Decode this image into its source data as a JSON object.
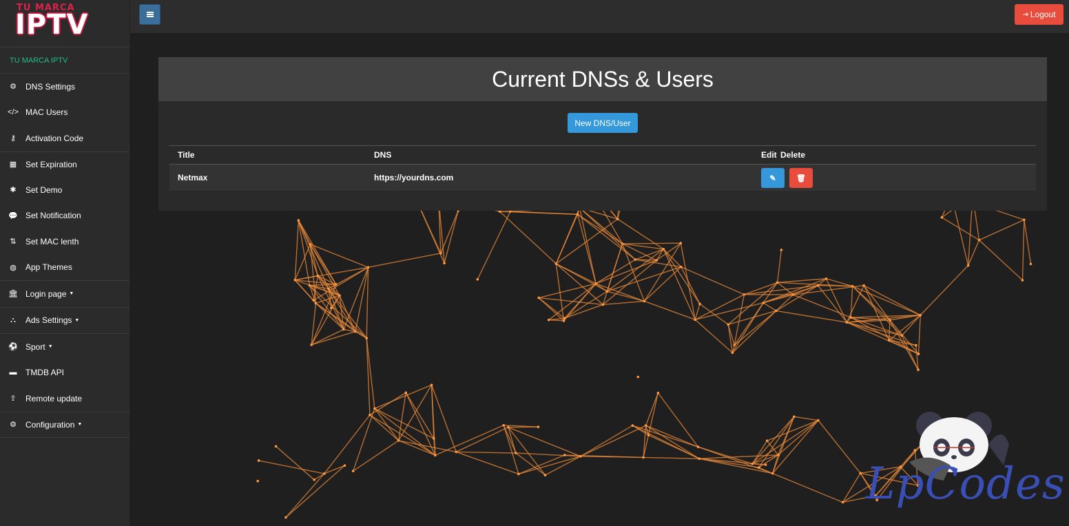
{
  "logo": {
    "top": "TU MARCA",
    "main": "IPTV"
  },
  "brand": "TU MARCA IPTV",
  "sidebar": {
    "items": [
      {
        "label": "DNS Settings",
        "icon": "gears-icon"
      },
      {
        "label": "MAC Users",
        "icon": "code-icon"
      },
      {
        "label": "Activation Code",
        "icon": "key-icon"
      },
      {
        "label": "Set Expiration",
        "icon": "calendar-icon"
      },
      {
        "label": "Set Demo",
        "icon": "asterisk-icon"
      },
      {
        "label": "Set Notification",
        "icon": "comment-icon"
      },
      {
        "label": "Set MAC lenth",
        "icon": "sort-icon"
      },
      {
        "label": "App Themes",
        "icon": "globe-icon"
      },
      {
        "label": "Login page",
        "icon": "bank-icon"
      },
      {
        "label": "Ads Settings",
        "icon": "binoculars-icon"
      },
      {
        "label": "Sport",
        "icon": "soccer-ball-icon"
      },
      {
        "label": "TMDB API",
        "icon": "id-card-icon"
      },
      {
        "label": "Remote update",
        "icon": "upload-icon"
      },
      {
        "label": "Configuration",
        "icon": "cog-icon"
      }
    ]
  },
  "topbar": {
    "logout_label": "Logout"
  },
  "main": {
    "title": "Current DNSs & Users",
    "new_button": "New DNS/User",
    "table": {
      "headers": [
        "Title",
        "DNS",
        "Edit",
        "Delete"
      ],
      "rows": [
        {
          "title": "Netmax",
          "dns": "https://yourdns.com"
        }
      ]
    }
  },
  "watermark": "LpCodes",
  "colors": {
    "accent": "#3498db",
    "danger": "#e74c3c",
    "brand": "#1fbf8a",
    "network": "#f08a3a"
  }
}
